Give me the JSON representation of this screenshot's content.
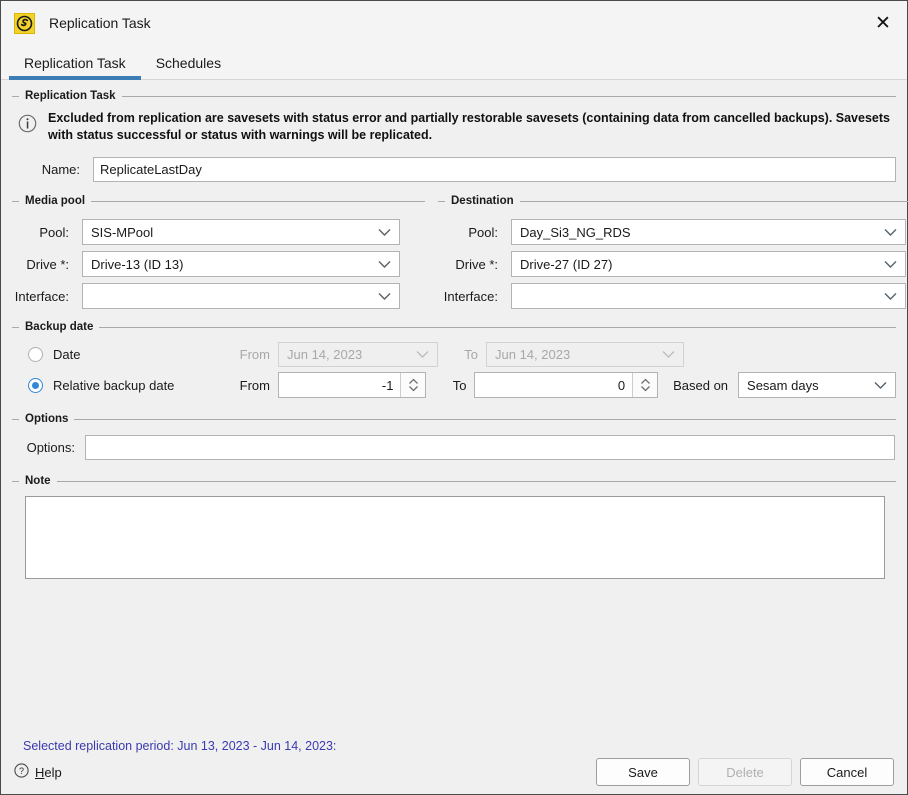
{
  "window": {
    "title": "Replication Task",
    "app_icon": "sesam-logo-icon",
    "close_label": "✕"
  },
  "tabs": [
    {
      "label": "Replication Task",
      "active": true
    },
    {
      "label": "Schedules",
      "active": false
    }
  ],
  "groups": {
    "replication_task": {
      "title": "Replication Task",
      "info_icon": "info-circle-icon",
      "info_text": "Excluded from replication are savesets with status error and partially restorable savesets (containing data from cancelled backups). Savesets with status successful or status with warnings will be replicated.",
      "name_label": "Name:",
      "name_value": "ReplicateLastDay",
      "name_placeholder": ""
    },
    "media_pool": {
      "title": "Media pool",
      "pool_label": "Pool:",
      "pool_value": "SIS-MPool",
      "drive_label": "Drive *:",
      "drive_value": "Drive-13 (ID 13)",
      "interface_label": "Interface:",
      "interface_value": ""
    },
    "destination": {
      "title": "Destination",
      "pool_label": "Pool:",
      "pool_value": "Day_Si3_NG_RDS",
      "drive_label": "Drive *:",
      "drive_value": "Drive-27 (ID 27)",
      "interface_label": "Interface:",
      "interface_value": ""
    },
    "backup_date": {
      "title": "Backup date",
      "date_radio_label": "Date",
      "date_radio_selected": false,
      "date_from_label": "From",
      "date_from_value": "Jun 14, 2023",
      "date_to_label": "To",
      "date_to_value": "Jun 14, 2023",
      "relative_radio_label": "Relative backup date",
      "relative_radio_selected": true,
      "relative_from_label": "From",
      "relative_from_value": "-1",
      "relative_to_label": "To",
      "relative_to_value": "0",
      "based_on_label": "Based on",
      "based_on_value": "Sesam days"
    },
    "options": {
      "title": "Options",
      "options_label": "Options:",
      "options_value": ""
    },
    "note": {
      "title": "Note",
      "note_value": ""
    }
  },
  "footer": {
    "selected_period": "Selected replication period: Jun 13, 2023 - Jun 14, 2023:",
    "help_icon": "question-circle-icon",
    "help_prefix": "H",
    "help_suffix": "elp",
    "save_label": "Save",
    "delete_label": "Delete",
    "cancel_label": "Cancel"
  },
  "colors": {
    "accent_blue": "#3d7db5",
    "link_blue": "#3a3ab0",
    "radio_blue": "#2f87d6",
    "icon_yellow": "#f2d22b",
    "background": "#f0f0f0"
  }
}
